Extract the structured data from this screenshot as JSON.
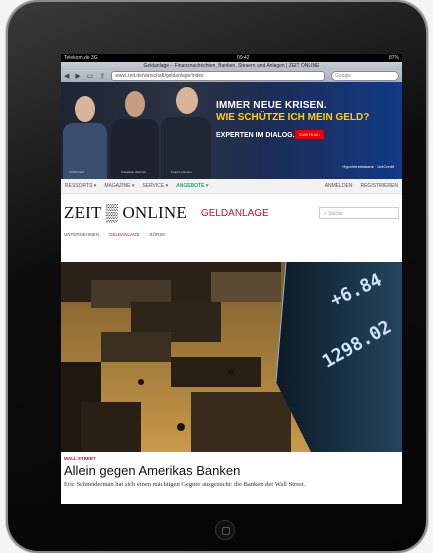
{
  "status": {
    "carrier": "Telekom.de 3G",
    "time": "09:42",
    "battery": "87%"
  },
  "browser": {
    "title": "Geldanlage – Finanznachrichten, Banken, Steuern und Anlagen | ZEIT ONLINE",
    "url": "www.zeit.de/wirtschaft/geldanlage/index",
    "search_placeholder": "Google"
  },
  "ad": {
    "line1": "IMMER NEUE KRISEN.",
    "line2": "WIE SCHÜTZE ICH MEIN GELD?",
    "line3": "EXPERTEN IM DIALOG.",
    "button": "ZUM FILM ›",
    "sponsor": "HypoVereinsbank · UniCredit",
    "captions": [
      "Ulf Bohnert",
      "Sebastian Weichel",
      "Frank Lehmann"
    ]
  },
  "nav": {
    "items": [
      "RESSORTS ▾",
      "MAGAZINE ▾",
      "SERVICE ▾",
      "ANGEBOTE ▾"
    ],
    "login": "ANMELDEN",
    "register": "REGISTRIEREN"
  },
  "site": {
    "logo": "ZEIT ▒ ONLINE",
    "section": "GELDANLAGE",
    "search_placeholder": "Suche",
    "subnav": [
      "UNTERNEHMEN",
      "GELDANLAGE",
      "BÖRSE"
    ]
  },
  "photo": {
    "ticker1": "+6.84",
    "ticker2": "1298.02"
  },
  "article": {
    "kicker": "WALL STREET",
    "headline": "Allein gegen Amerikas Banken",
    "teaser": "Eric Schneiderman hat sich einen mächtigen Gegner ausgesucht: die Banken der Wall Street."
  }
}
